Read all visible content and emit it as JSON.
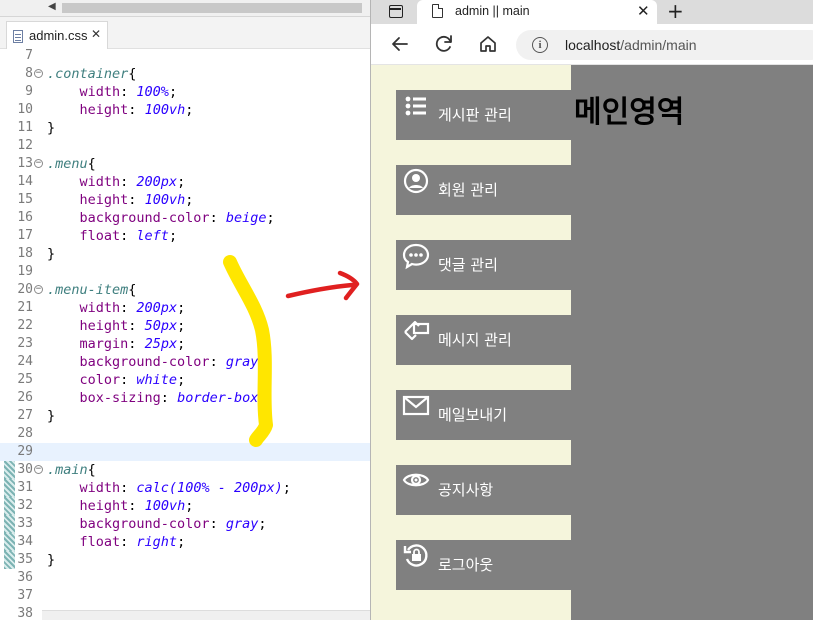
{
  "editor": {
    "tab_filename": "admin.css",
    "tab_close": "✕",
    "scroll_arrow": "◀",
    "lines": [
      {
        "num": "7",
        "parts": []
      },
      {
        "num": "8",
        "fold": true,
        "parts": [
          {
            "t": "sel",
            "v": ".container"
          },
          {
            "t": "punct",
            "v": "{"
          }
        ]
      },
      {
        "num": "9",
        "parts": [
          {
            "t": "ind",
            "v": "    "
          },
          {
            "t": "prop",
            "v": "width"
          },
          {
            "t": "punct",
            "v": ": "
          },
          {
            "t": "val",
            "v": "100%"
          },
          {
            "t": "punct",
            "v": ";"
          }
        ]
      },
      {
        "num": "10",
        "parts": [
          {
            "t": "ind",
            "v": "    "
          },
          {
            "t": "prop",
            "v": "height"
          },
          {
            "t": "punct",
            "v": ": "
          },
          {
            "t": "val",
            "v": "100vh"
          },
          {
            "t": "punct",
            "v": ";"
          }
        ]
      },
      {
        "num": "11",
        "parts": [
          {
            "t": "punct",
            "v": "}"
          }
        ]
      },
      {
        "num": "12",
        "parts": []
      },
      {
        "num": "13",
        "fold": true,
        "parts": [
          {
            "t": "sel",
            "v": ".menu"
          },
          {
            "t": "punct",
            "v": "{"
          }
        ]
      },
      {
        "num": "14",
        "parts": [
          {
            "t": "ind",
            "v": "    "
          },
          {
            "t": "prop",
            "v": "width"
          },
          {
            "t": "punct",
            "v": ": "
          },
          {
            "t": "val",
            "v": "200px"
          },
          {
            "t": "punct",
            "v": ";"
          }
        ]
      },
      {
        "num": "15",
        "parts": [
          {
            "t": "ind",
            "v": "    "
          },
          {
            "t": "prop",
            "v": "height"
          },
          {
            "t": "punct",
            "v": ": "
          },
          {
            "t": "val",
            "v": "100vh"
          },
          {
            "t": "punct",
            "v": ";"
          }
        ]
      },
      {
        "num": "16",
        "parts": [
          {
            "t": "ind",
            "v": "    "
          },
          {
            "t": "prop",
            "v": "background-color"
          },
          {
            "t": "punct",
            "v": ": "
          },
          {
            "t": "val",
            "v": "beige"
          },
          {
            "t": "punct",
            "v": ";"
          }
        ]
      },
      {
        "num": "17",
        "parts": [
          {
            "t": "ind",
            "v": "    "
          },
          {
            "t": "prop",
            "v": "float"
          },
          {
            "t": "punct",
            "v": ": "
          },
          {
            "t": "val",
            "v": "left"
          },
          {
            "t": "punct",
            "v": ";"
          }
        ]
      },
      {
        "num": "18",
        "parts": [
          {
            "t": "punct",
            "v": "}"
          }
        ]
      },
      {
        "num": "19",
        "parts": []
      },
      {
        "num": "20",
        "fold": true,
        "parts": [
          {
            "t": "sel",
            "v": ".menu-item"
          },
          {
            "t": "punct",
            "v": "{"
          }
        ]
      },
      {
        "num": "21",
        "parts": [
          {
            "t": "ind",
            "v": "    "
          },
          {
            "t": "prop",
            "v": "width"
          },
          {
            "t": "punct",
            "v": ": "
          },
          {
            "t": "val",
            "v": "200px"
          },
          {
            "t": "punct",
            "v": ";"
          }
        ]
      },
      {
        "num": "22",
        "parts": [
          {
            "t": "ind",
            "v": "    "
          },
          {
            "t": "prop",
            "v": "height"
          },
          {
            "t": "punct",
            "v": ": "
          },
          {
            "t": "val",
            "v": "50px"
          },
          {
            "t": "punct",
            "v": ";"
          }
        ]
      },
      {
        "num": "23",
        "parts": [
          {
            "t": "ind",
            "v": "    "
          },
          {
            "t": "prop",
            "v": "margin"
          },
          {
            "t": "punct",
            "v": ": "
          },
          {
            "t": "val",
            "v": "25px"
          },
          {
            "t": "punct",
            "v": ";"
          }
        ]
      },
      {
        "num": "24",
        "parts": [
          {
            "t": "ind",
            "v": "    "
          },
          {
            "t": "prop",
            "v": "background-color"
          },
          {
            "t": "punct",
            "v": ": "
          },
          {
            "t": "val",
            "v": "gray"
          },
          {
            "t": "punct",
            "v": ";"
          }
        ]
      },
      {
        "num": "25",
        "parts": [
          {
            "t": "ind",
            "v": "    "
          },
          {
            "t": "prop",
            "v": "color"
          },
          {
            "t": "punct",
            "v": ": "
          },
          {
            "t": "val",
            "v": "white"
          },
          {
            "t": "punct",
            "v": ";"
          }
        ]
      },
      {
        "num": "26",
        "parts": [
          {
            "t": "ind",
            "v": "    "
          },
          {
            "t": "prop",
            "v": "box-sizing"
          },
          {
            "t": "punct",
            "v": ": "
          },
          {
            "t": "val",
            "v": "border-box"
          },
          {
            "t": "punct",
            "v": ";"
          }
        ]
      },
      {
        "num": "27",
        "parts": [
          {
            "t": "punct",
            "v": "}"
          }
        ]
      },
      {
        "num": "28",
        "parts": []
      },
      {
        "num": "29",
        "active": true,
        "parts": []
      },
      {
        "num": "30",
        "fold": true,
        "changed": true,
        "parts": [
          {
            "t": "sel",
            "v": ".main"
          },
          {
            "t": "punct",
            "v": "{"
          }
        ]
      },
      {
        "num": "31",
        "changed": true,
        "parts": [
          {
            "t": "ind",
            "v": "    "
          },
          {
            "t": "prop",
            "v": "width"
          },
          {
            "t": "punct",
            "v": ": "
          },
          {
            "t": "val",
            "v": "calc(100% - 200px)"
          },
          {
            "t": "punct",
            "v": ";"
          }
        ]
      },
      {
        "num": "32",
        "changed": true,
        "parts": [
          {
            "t": "ind",
            "v": "    "
          },
          {
            "t": "prop",
            "v": "height"
          },
          {
            "t": "punct",
            "v": ": "
          },
          {
            "t": "val",
            "v": "100vh"
          },
          {
            "t": "punct",
            "v": ";"
          }
        ]
      },
      {
        "num": "33",
        "changed": true,
        "parts": [
          {
            "t": "ind",
            "v": "    "
          },
          {
            "t": "prop",
            "v": "background-color"
          },
          {
            "t": "punct",
            "v": ": "
          },
          {
            "t": "val",
            "v": "gray"
          },
          {
            "t": "punct",
            "v": ";"
          }
        ]
      },
      {
        "num": "34",
        "changed": true,
        "parts": [
          {
            "t": "ind",
            "v": "    "
          },
          {
            "t": "prop",
            "v": "float"
          },
          {
            "t": "punct",
            "v": ": "
          },
          {
            "t": "val",
            "v": "right"
          },
          {
            "t": "punct",
            "v": ";"
          }
        ]
      },
      {
        "num": "35",
        "changed": true,
        "parts": [
          {
            "t": "punct",
            "v": "}"
          }
        ]
      },
      {
        "num": "36",
        "parts": []
      },
      {
        "num": "37",
        "parts": []
      },
      {
        "num": "38",
        "parts": []
      }
    ]
  },
  "annotations": {
    "highlighter_color": "#ffe600",
    "arrow_color": "#e02020"
  },
  "browser": {
    "tab_title": "admin || main",
    "tab_close": "✕",
    "new_tab": "+",
    "back_icon": "back-arrow-icon",
    "reload_icon": "reload-icon",
    "home_icon": "home-icon",
    "url_host": "localhost",
    "url_path": "/admin/main",
    "info_glyph": "i"
  },
  "page": {
    "menu": [
      {
        "label": "게시판 관리",
        "icon": "list-icon"
      },
      {
        "label": "회원 관리",
        "icon": "user-circle-icon"
      },
      {
        "label": "댓글 관리",
        "icon": "comment-dots-icon"
      },
      {
        "label": "메시지 관리",
        "icon": "message-send-icon"
      },
      {
        "label": "메일보내기",
        "icon": "envelope-icon"
      },
      {
        "label": "공지사항",
        "icon": "eye-icon"
      },
      {
        "label": "로그아웃",
        "icon": "logout-lock-icon"
      }
    ],
    "main_heading": "메인영역",
    "colors": {
      "menu_bg": "beige",
      "item_bg": "gray",
      "main_bg": "gray"
    }
  }
}
